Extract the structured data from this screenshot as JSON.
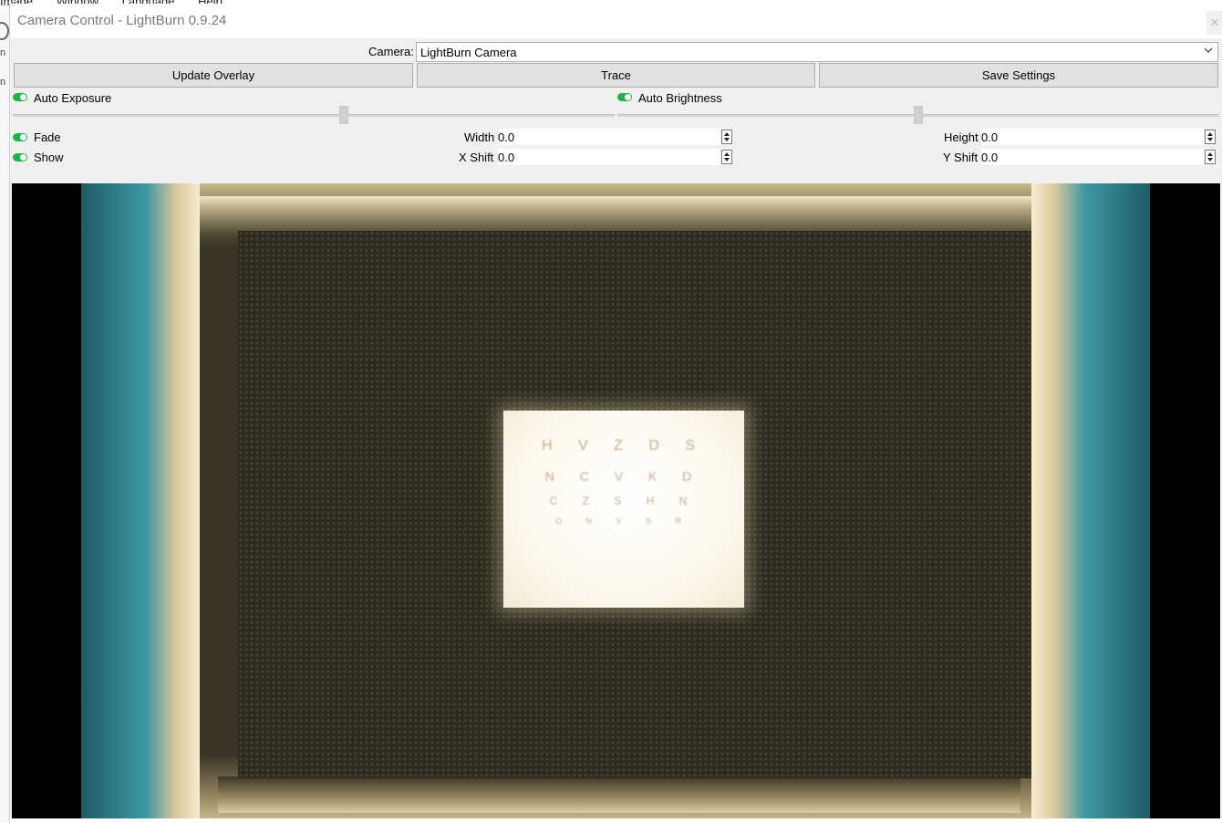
{
  "background_app": {
    "menu": [
      "Image",
      "Window",
      "Language",
      "Help"
    ],
    "left_strip_glyphs": [
      "n",
      "n"
    ]
  },
  "window": {
    "title": "Camera Control - LightBurn 0.9.24",
    "close_glyph": "✕"
  },
  "camera": {
    "label": "Camera:",
    "selected": "LightBurn Camera"
  },
  "buttons": {
    "update_overlay": "Update Overlay",
    "trace": "Trace",
    "save_settings": "Save Settings"
  },
  "exposure": {
    "label": "Auto Exposure",
    "enabled": true,
    "slider_level": 0.55
  },
  "brightness": {
    "label": "Auto Brightness",
    "enabled": true,
    "slider_level": 0.5
  },
  "overlay": {
    "fade_label": "Fade",
    "fade_enabled": true,
    "show_label": "Show",
    "show_enabled": true,
    "width_label": "Width",
    "width_value": "0.0",
    "height_label": "Height",
    "height_value": "0.0",
    "xshift_label": "X Shift",
    "xshift_value": "0.0",
    "yshift_label": "Y Shift",
    "yshift_value": "0.0"
  },
  "feed": {
    "card_lines": [
      "H V Z D S",
      "N C V K D",
      "C Z S H N",
      "O N V S R"
    ],
    "accent_teal": "#2e7e8a",
    "toggle_green": "#1fb34a"
  }
}
